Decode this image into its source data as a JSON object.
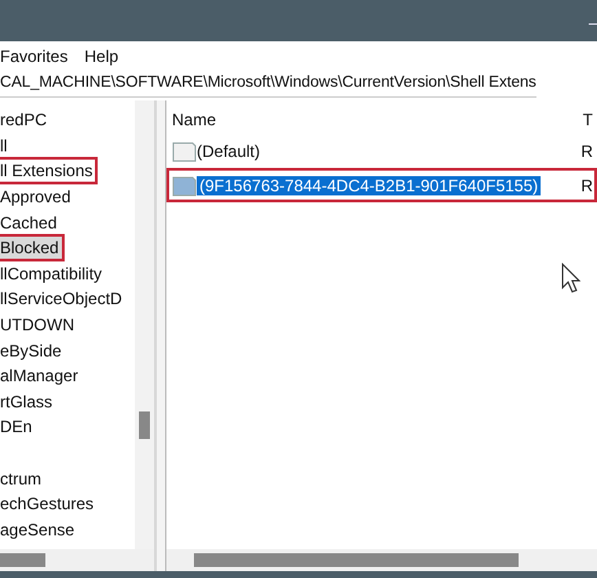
{
  "menu": [
    "Favorites",
    "Help"
  ],
  "address": "CAL_MACHINE\\SOFTWARE\\Microsoft\\Windows\\CurrentVersion\\Shell Extens",
  "tree": [
    {
      "label": "redPC",
      "selected": false,
      "annotated": false
    },
    {
      "label": "ll",
      "selected": false,
      "annotated": false
    },
    {
      "label": "ll Extensions",
      "selected": false,
      "annotated": true
    },
    {
      "label": "Approved",
      "selected": false,
      "annotated": false
    },
    {
      "label": "Cached",
      "selected": false,
      "annotated": false
    },
    {
      "label": "Blocked",
      "selected": true,
      "annotated": true
    },
    {
      "label": "llCompatibility",
      "selected": false,
      "annotated": false
    },
    {
      "label": "llServiceObjectD",
      "selected": false,
      "annotated": false
    },
    {
      "label": "UTDOWN",
      "selected": false,
      "annotated": false
    },
    {
      "label": "eBySide",
      "selected": false,
      "annotated": false
    },
    {
      "label": "alManager",
      "selected": false,
      "annotated": false
    },
    {
      "label": "rtGlass",
      "selected": false,
      "annotated": false
    },
    {
      "label": "DEn",
      "selected": false,
      "annotated": false
    },
    {
      "selected": false,
      "annotated": false
    },
    {
      "label": "ctrum",
      "selected": false,
      "annotated": false
    },
    {
      "label": "echGestures",
      "selected": false,
      "annotated": false
    },
    {
      "label": "ageSense",
      "selected": false,
      "annotated": false
    }
  ],
  "columns": [
    "Name",
    "T"
  ],
  "values": [
    {
      "name": "(Default)",
      "type": "R",
      "selected": false,
      "annotated": false
    },
    {
      "name": "(9F156763-7844-4DC4-B2B1-901F640F5155)",
      "type": "R",
      "selected": true,
      "annotated": true
    }
  ]
}
